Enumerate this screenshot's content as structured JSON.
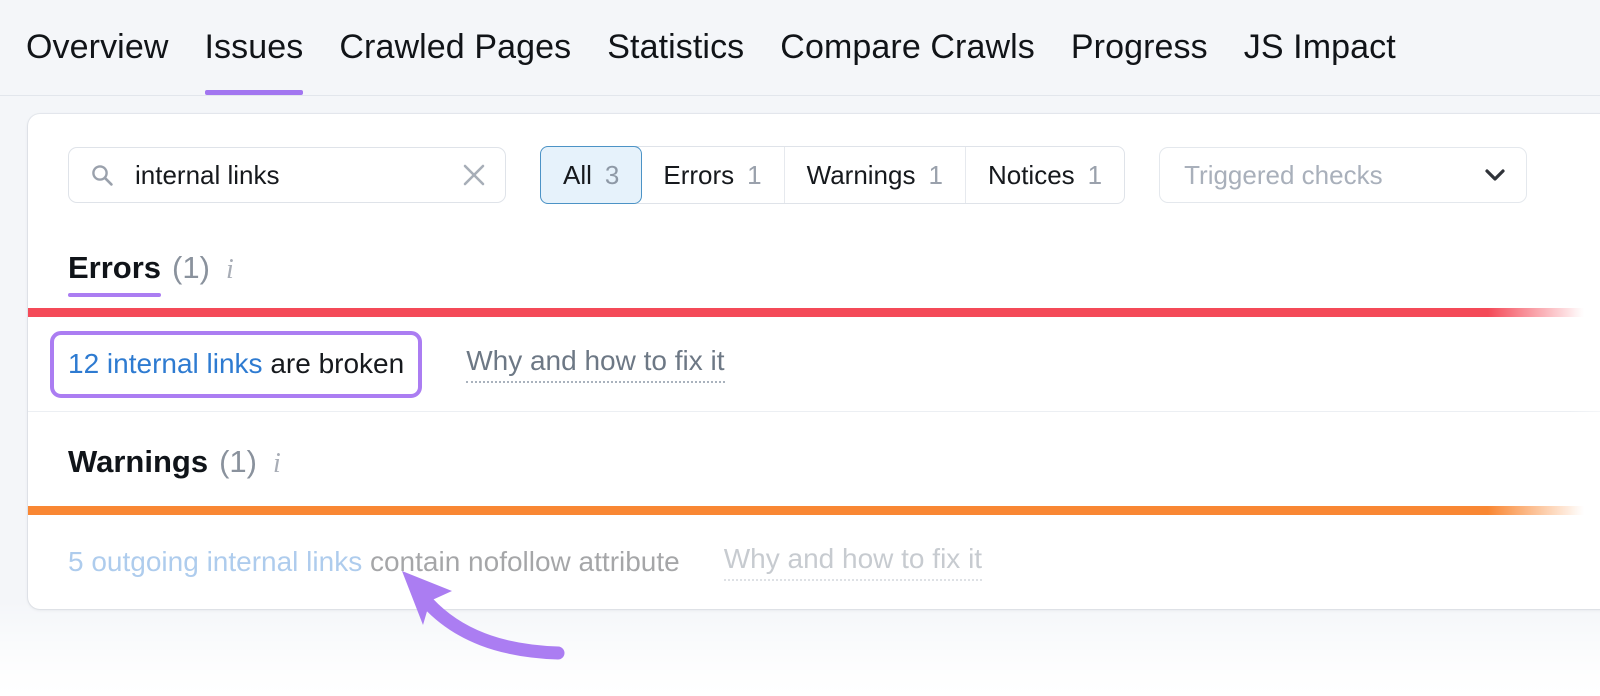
{
  "nav": {
    "tabs": [
      {
        "label": "Overview",
        "active": false
      },
      {
        "label": "Issues",
        "active": true
      },
      {
        "label": "Crawled Pages",
        "active": false
      },
      {
        "label": "Statistics",
        "active": false
      },
      {
        "label": "Compare Crawls",
        "active": false
      },
      {
        "label": "Progress",
        "active": false
      },
      {
        "label": "JS Impact",
        "active": false
      }
    ]
  },
  "toolbar": {
    "search": {
      "icon": "search-icon",
      "value": "internal links",
      "placeholder": "Search",
      "clear_icon": "close-icon"
    },
    "segments": [
      {
        "label": "All",
        "count": "3",
        "selected": true
      },
      {
        "label": "Errors",
        "count": "1",
        "selected": false
      },
      {
        "label": "Warnings",
        "count": "1",
        "selected": false
      },
      {
        "label": "Notices",
        "count": "1",
        "selected": false
      }
    ],
    "dropdown": {
      "label": "Triggered checks",
      "icon": "chevron-down-icon"
    }
  },
  "sections": {
    "errors": {
      "title": "Errors",
      "count": "(1)",
      "info_icon": "info-icon",
      "bar_color": "#f44a58",
      "rows": [
        {
          "link_text": "12 internal links",
          "rest_text": " are broken",
          "fix_label": "Why and how to fix it"
        }
      ]
    },
    "warnings": {
      "title": "Warnings",
      "count": "(1)",
      "info_icon": "info-icon",
      "bar_color": "#f98733",
      "rows": [
        {
          "link_text": "5 outgoing internal links",
          "rest_text": " contain nofollow attribute",
          "fix_label": "Why and how to fix it"
        }
      ]
    }
  },
  "annotation": {
    "arrow_color": "#ab7df2",
    "highlight_color": "#ab7df2"
  }
}
